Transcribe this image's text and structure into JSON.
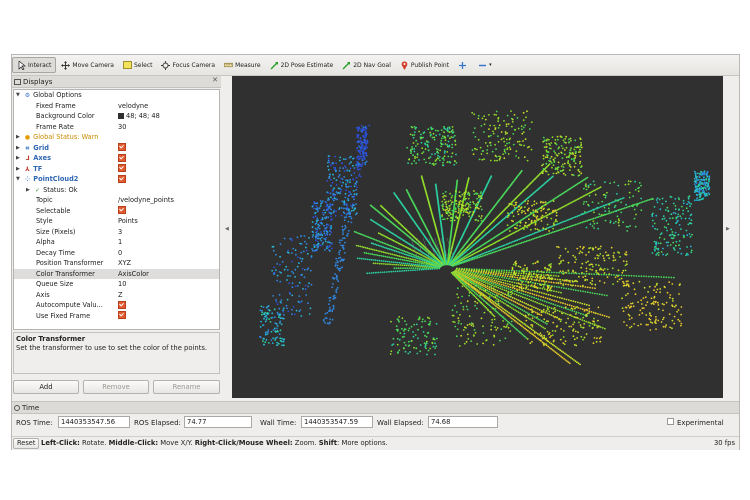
{
  "toolbar": {
    "tools": [
      {
        "label": "Interact",
        "icon": "cursor-icon",
        "active": true
      },
      {
        "label": "Move Camera",
        "icon": "move-camera-icon"
      },
      {
        "label": "Select",
        "icon": "select-icon"
      },
      {
        "label": "Focus Camera",
        "icon": "focus-camera-icon"
      },
      {
        "label": "Measure",
        "icon": "ruler-icon"
      },
      {
        "label": "2D Pose Estimate",
        "icon": "pose-arrow-icon"
      },
      {
        "label": "2D Nav Goal",
        "icon": "nav-arrow-icon"
      },
      {
        "label": "Publish Point",
        "icon": "map-pin-icon"
      }
    ]
  },
  "displays": {
    "title": "Displays",
    "rows": [
      {
        "label": "Global Options",
        "value": "",
        "indent": 0,
        "icon": "gear",
        "expanded": true
      },
      {
        "label": "Fixed Frame",
        "value": "velodyne",
        "indent": 1
      },
      {
        "label": "Background Color",
        "value": "48; 48; 48",
        "indent": 1,
        "swatch": true
      },
      {
        "label": "Frame Rate",
        "value": "30",
        "indent": 1
      },
      {
        "label": "Global Status: Warn",
        "value": "",
        "indent": 0,
        "icon": "warn",
        "collapsed": true,
        "style": "warn"
      },
      {
        "label": "Grid",
        "value": "",
        "indent": 0,
        "icon": "grid",
        "collapsed": true,
        "style": "blue",
        "check": true
      },
      {
        "label": "Axes",
        "value": "",
        "indent": 0,
        "icon": "axes",
        "collapsed": true,
        "style": "blue",
        "check": true
      },
      {
        "label": "TF",
        "value": "",
        "indent": 0,
        "icon": "tf",
        "collapsed": true,
        "style": "blue",
        "check": true
      },
      {
        "label": "PointCloud2",
        "value": "",
        "indent": 0,
        "icon": "cloud",
        "expanded": true,
        "style": "blue",
        "check": true
      },
      {
        "label": "Status: Ok",
        "value": "",
        "indent": 1,
        "icon": "ok",
        "collapsed": true
      },
      {
        "label": "Topic",
        "value": "/velodyne_points",
        "indent": 1
      },
      {
        "label": "Selectable",
        "value": "",
        "indent": 1,
        "check": true
      },
      {
        "label": "Style",
        "value": "Points",
        "indent": 1
      },
      {
        "label": "Size (Pixels)",
        "value": "3",
        "indent": 1
      },
      {
        "label": "Alpha",
        "value": "1",
        "indent": 1
      },
      {
        "label": "Decay Time",
        "value": "0",
        "indent": 1
      },
      {
        "label": "Position Transformer",
        "value": "XYZ",
        "indent": 1
      },
      {
        "label": "Color Transformer",
        "value": "AxisColor",
        "indent": 1,
        "selected": true
      },
      {
        "label": "Queue Size",
        "value": "10",
        "indent": 1
      },
      {
        "label": "Axis",
        "value": "Z",
        "indent": 1
      },
      {
        "label": "Autocompute Valu...",
        "value": "",
        "indent": 1,
        "check": true
      },
      {
        "label": "Use Fixed Frame",
        "value": "",
        "indent": 1,
        "check": true
      }
    ],
    "description_title": "Color Transformer",
    "description_text": "Set the transformer to use to set the color of the points.",
    "add_label": "Add",
    "remove_label": "Remove",
    "rename_label": "Rename"
  },
  "time": {
    "title": "Time",
    "ros_time_label": "ROS Time:",
    "ros_time_value": "1440353547.56",
    "ros_elapsed_label": "ROS Elapsed:",
    "ros_elapsed_value": "74.77",
    "wall_time_label": "Wall Time:",
    "wall_time_value": "1440353547.59",
    "wall_elapsed_label": "Wall Elapsed:",
    "wall_elapsed_value": "74.68",
    "experimental_label": "Experimental"
  },
  "status": {
    "reset_label": "Reset",
    "hint_b1": "Left-Click:",
    "hint_t1": " Rotate. ",
    "hint_b2": "Middle-Click:",
    "hint_t2": " Move X/Y. ",
    "hint_b3": "Right-Click/Mouse Wheel:",
    "hint_t3": " Zoom. ",
    "hint_b4": "Shift",
    "hint_t4": ": More options.",
    "fps": "30 fps"
  },
  "colors": {
    "viewport_background": "#303030",
    "check_orange": "#e15a2e",
    "display_blue": "#2f66b2",
    "warn_orange": "#c98a00"
  }
}
